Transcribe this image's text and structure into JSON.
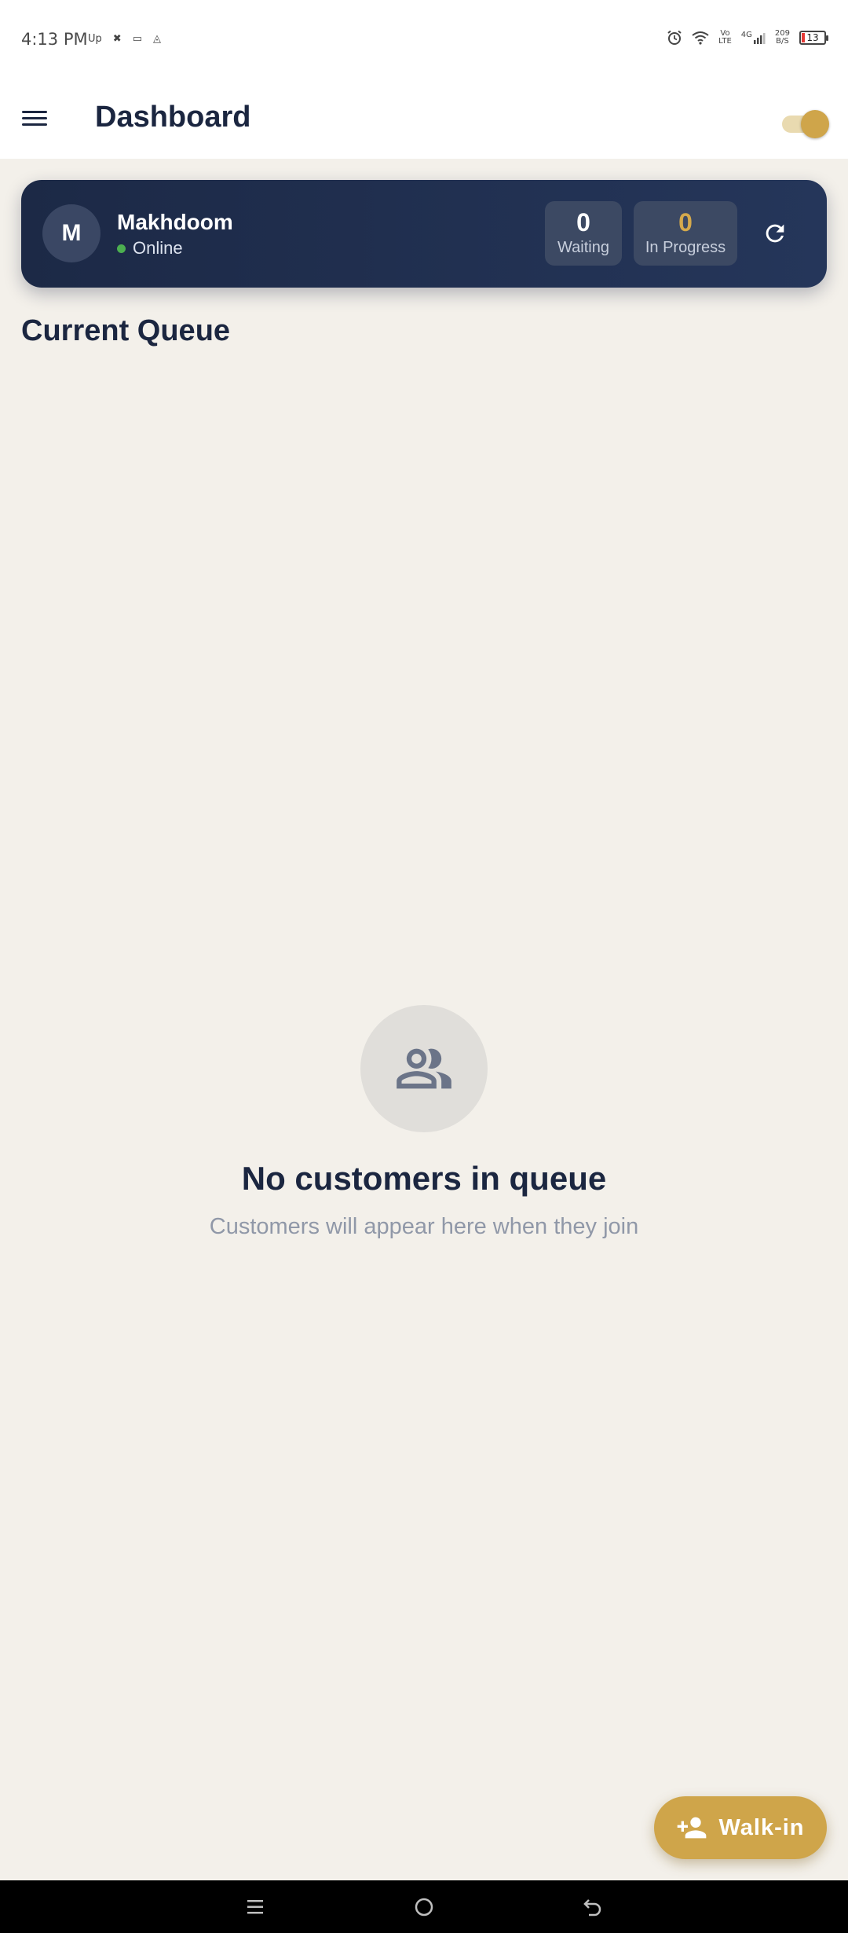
{
  "status_bar": {
    "time": "4:13 PM",
    "left_icons": [
      "upwork-icon",
      "bird-icon",
      "message-icon",
      "drive-icon"
    ],
    "left_icon_glyphs": [
      "Up",
      "✖",
      "▭",
      "◬"
    ],
    "network_vo": "Vo",
    "network_lte": "LTE",
    "network_4g": "4G",
    "speed_value": "209",
    "speed_unit": "B/S",
    "battery_level": "13"
  },
  "app_bar": {
    "title": "Dashboard",
    "toggle_on": true
  },
  "profile": {
    "avatar_initial": "M",
    "name": "Makhdoom",
    "status": "Online",
    "stats": {
      "waiting_value": "0",
      "waiting_label": "Waiting",
      "in_progress_value": "0",
      "in_progress_label": "In Progress"
    }
  },
  "queue": {
    "title": "Current Queue",
    "empty_title": "No customers in queue",
    "empty_subtitle": "Customers will appear here when they join"
  },
  "fab": {
    "label": "Walk-in"
  },
  "colors": {
    "background": "#F3F0EA",
    "navy": "#1B2640",
    "gold": "#CFA54A",
    "online_green": "#4CAF50"
  }
}
